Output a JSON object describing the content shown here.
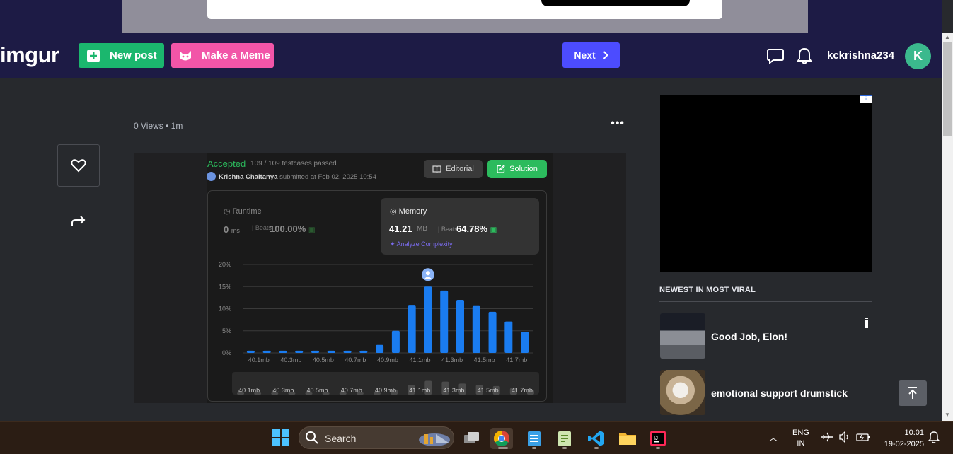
{
  "header": {
    "logo": "imgur",
    "new_post": "New post",
    "make_meme": "Make a Meme",
    "next": "Next",
    "username": "kckrishna234",
    "avatar_letter": "K"
  },
  "post": {
    "meta": "0 Views • 1m",
    "options": "•••"
  },
  "submission": {
    "status": "Accepted",
    "testcases": "109 / 109 testcases passed",
    "submitter_name": "Krishna Chaitanya",
    "submitted_at": "submitted at Feb 02, 2025 10:54",
    "editorial": "Editorial",
    "solution": "Solution",
    "runtime_label": "Runtime",
    "runtime_value": "0",
    "runtime_unit": "ms",
    "beats": "Beats",
    "runtime_pct": "100.00%",
    "memory_label": "Memory",
    "memory_value": "41.21",
    "memory_unit": "MB",
    "memory_pct": "64.78%",
    "analyze": "Analyze Complexity"
  },
  "chart_data": {
    "type": "bar",
    "ylabel": "",
    "xlabel": "",
    "yticks": [
      "20%",
      "15%",
      "10%",
      "5%",
      "0%"
    ],
    "ylim": [
      0,
      20
    ],
    "xtick_labels": [
      "40.1mb",
      "40.3mb",
      "40.5mb",
      "40.7mb",
      "40.9mb",
      "41.1mb",
      "41.3mb",
      "41.5mb",
      "41.7mb"
    ],
    "values": [
      0.5,
      0.5,
      0.5,
      0.5,
      0.5,
      0.5,
      0.5,
      0.5,
      1.8,
      5.0,
      10.7,
      15.0,
      14.1,
      12.0,
      10.6,
      9.3,
      7.1,
      4.8
    ],
    "user_bin_index": 11,
    "bar_color": "#1a7cf0",
    "overview_labels": [
      "40.1mb",
      "40.3mb",
      "40.5mb",
      "40.7mb",
      "40.9mb",
      "41.1mb",
      "41.3mb",
      "41.5mb",
      "41.7mb"
    ]
  },
  "sidebar": {
    "ad_info": "i",
    "newest_heading": "NEWEST IN MOST VIRAL",
    "items": [
      {
        "title": "Good Job, Elon!"
      },
      {
        "title": "emotional support drumstick"
      }
    ]
  },
  "taskbar": {
    "search": "Search",
    "lang_line1": "ENG",
    "lang_line2": "IN",
    "time": "10:01",
    "date": "19-02-2025"
  }
}
